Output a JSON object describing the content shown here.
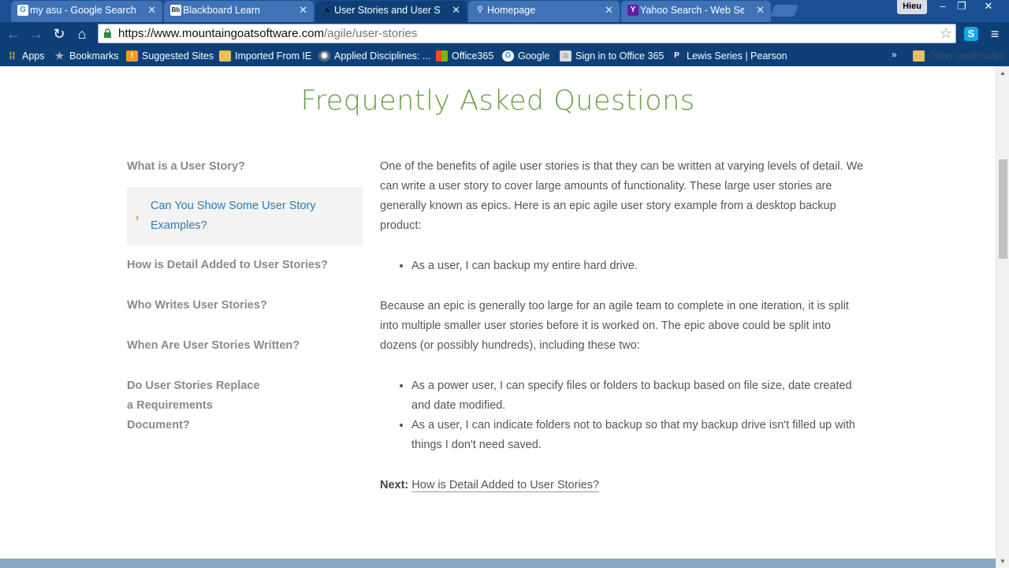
{
  "browser": {
    "tabs": [
      {
        "title": "my asu - Google Search",
        "icon": "google-icon"
      },
      {
        "title": "Blackboard Learn",
        "icon": "blackboard-icon"
      },
      {
        "title": "User Stories and User Stor",
        "icon": "mountain-goat-icon"
      },
      {
        "title": "Homepage",
        "icon": "search-icon"
      },
      {
        "title": "Yahoo Search - Web Searc",
        "icon": "yahoo-icon"
      }
    ],
    "active_tab_index": 2,
    "profile_name": "Hieu",
    "url_host": "https://www.mountaingoatsoftware.com",
    "url_path": "/agile/user-stories",
    "bookmarks": [
      {
        "label": "Apps",
        "icon": "apps-grid-icon"
      },
      {
        "label": "Bookmarks",
        "icon": "star-icon"
      },
      {
        "label": "Suggested Sites",
        "icon": "suggested-sites-icon"
      },
      {
        "label": "Imported From IE",
        "icon": "folder-icon"
      },
      {
        "label": "Applied Disciplines: ...",
        "icon": "page-icon"
      },
      {
        "label": "Office365",
        "icon": "office-icon"
      },
      {
        "label": "Google",
        "icon": "google-icon"
      },
      {
        "label": "Sign in to Office 365",
        "icon": "office-signin-icon"
      },
      {
        "label": "Lewis Series | Pearson",
        "icon": "pearson-icon"
      }
    ],
    "other_bookmarks": "Other bookmarks",
    "colors": {
      "frame": "#0e4077",
      "tab_inactive": "#3f73b6"
    }
  },
  "page": {
    "title": "Frequently Asked Questions",
    "nav": [
      "What is a User Story?",
      "Can You Show Some User Story Examples?",
      "How is Detail Added to User Stories?",
      "Who Writes User Stories?",
      "When Are User Stories Written?",
      "Do User Stories Replace a Requirements Document?"
    ],
    "nav_active_index": 1,
    "article": {
      "p1": "One of the benefits of agile user stories is that they can be written at varying levels of detail. We can write a user story to cover large amounts of functionality. These large user stories are generally known as epics. Here is an epic agile user story example from a desktop backup product:",
      "bullets1": [
        "As a user, I can backup my entire hard drive."
      ],
      "p2": "Because an epic is generally too large for an agile team to complete in one iteration, it is split into multiple smaller user stories before it is worked on. The epic above could be split into dozens (or possibly hundreds), including these two:",
      "bullets2": [
        "As a power user, I can specify files or folders to backup based on file size, date created and date modified.",
        "As a user, I can indicate folders not to backup so that my backup drive isn't filled up with things I don't need saved."
      ],
      "next_label": "Next:",
      "next_link": "How is Detail Added to User Stories?"
    },
    "colors": {
      "title": "#6aa047",
      "active_link": "#2f79b7",
      "arrow": "#e08b2a",
      "nav": "#8a8a8a"
    }
  }
}
